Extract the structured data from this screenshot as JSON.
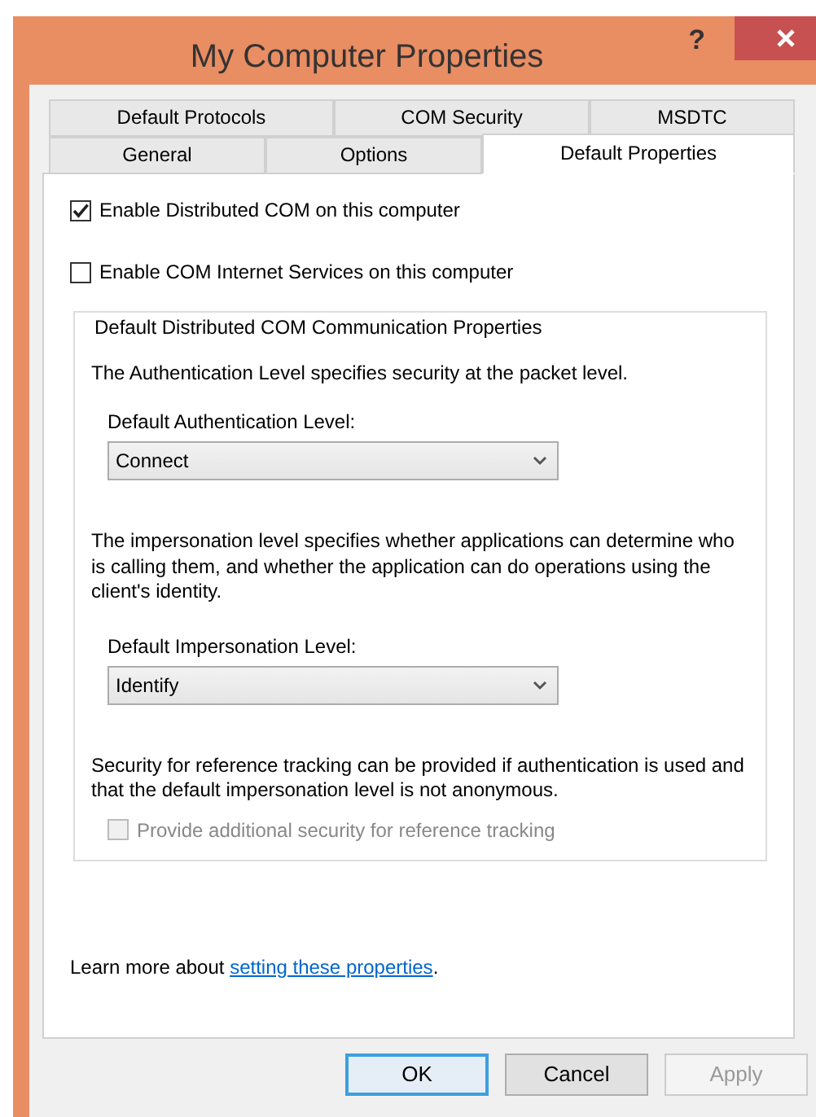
{
  "window": {
    "title": "My Computer Properties",
    "help": "?"
  },
  "tabs": [
    [
      {
        "label": "Default Protocols",
        "selected": false
      },
      {
        "label": "COM Security",
        "selected": false
      },
      {
        "label": "MSDTC",
        "selected": false
      }
    ],
    [
      {
        "label": "General",
        "selected": false
      },
      {
        "label": "Options",
        "selected": false
      },
      {
        "label": "Default Properties",
        "selected": true
      }
    ]
  ],
  "options": [
    {
      "label": "Enable Distributed COM on this computer",
      "checked": true,
      "disabled": false
    },
    {
      "label": "Enable COM Internet Services on this computer",
      "checked": false,
      "disabled": false
    }
  ],
  "group": {
    "legend": "Default Distributed COM Communication Properties",
    "auth_text": "The Authentication Level specifies security at the packet level.",
    "auth_label": "Default Authentication Level:",
    "auth_value": "Connect",
    "imp_text": "The impersonation level specifies whether applications can determine who is calling them, and whether the application can do operations using the client's identity.",
    "imp_label": "Default Impersonation Level:",
    "imp_value": "Identify",
    "ref_text": "Security for reference tracking can be provided if authentication is used and that the default impersonation level is not anonymous.",
    "ref_option": {
      "label": "Provide additional security for reference tracking",
      "checked": false,
      "disabled": true
    }
  },
  "learn": {
    "before": "Learn more about ",
    "link": "setting these properties",
    "after": "."
  },
  "buttons": [
    {
      "label": "OK",
      "default": true,
      "disabled": false
    },
    {
      "label": "Cancel",
      "default": false,
      "disabled": false
    },
    {
      "label": "Apply",
      "default": false,
      "disabled": true
    }
  ]
}
